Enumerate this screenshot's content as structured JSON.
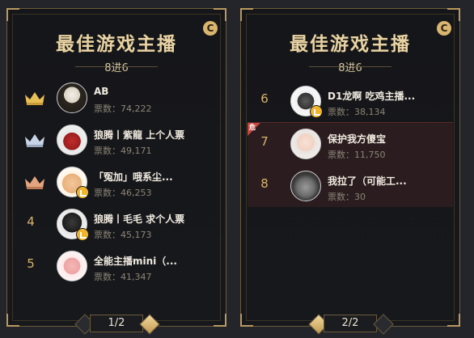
{
  "panels": [
    {
      "title": "最佳游戏主播",
      "subtitle": "8进6",
      "page": "1/2",
      "rows": [
        {
          "rank": "",
          "crown": "gold-crown-icon",
          "name": "AB",
          "votes": "票数：74,222"
        },
        {
          "rank": "",
          "crown": "silver-crown-icon",
          "name": "狼腾丨紫龍 上个人票",
          "votes": "票数：49,171"
        },
        {
          "rank": "",
          "crown": "bronze-crown-icon",
          "name": "「冤加」哦系尘...",
          "votes": "票数：46,253"
        },
        {
          "rank": "4",
          "name": "狼腾丨毛毛 求个人票",
          "votes": "票数：45,173"
        },
        {
          "rank": "5",
          "name": "全能主播mini（...",
          "votes": "票数：41,347"
        }
      ]
    },
    {
      "title": "最佳游戏主播",
      "subtitle": "8进6",
      "page": "2/2",
      "rows": [
        {
          "rank": "6",
          "name": "D1龙啊 吃鸡主播...",
          "votes": "票数：38,134"
        },
        {
          "rank": "7",
          "name": "保护我方傻宝",
          "votes": "票数：11,750",
          "tag": "危"
        },
        {
          "rank": "8",
          "name": "我拉了（可能工...",
          "votes": "票数：30"
        }
      ]
    }
  ],
  "colors": {
    "gold": "#d9b56e",
    "panel_bg": "#151619",
    "danger": "#c6473e"
  }
}
